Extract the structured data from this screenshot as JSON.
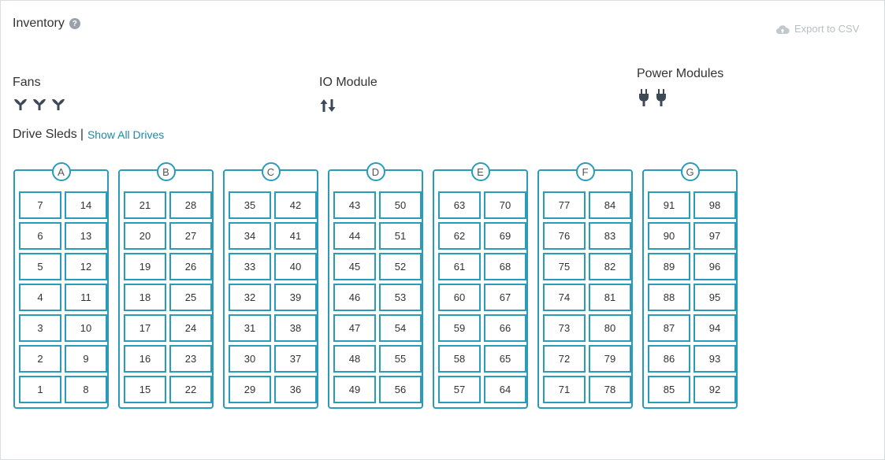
{
  "header": {
    "title": "Inventory",
    "help_glyph": "?",
    "export_label": "Export to CSV",
    "export_icon": "cloud-upload-icon"
  },
  "fans": {
    "label": "Fans",
    "count": 3,
    "icon": "fan-icon"
  },
  "io_module": {
    "label": "IO Module",
    "icon": "up-down-arrows-icon"
  },
  "power_modules": {
    "label": "Power Modules",
    "count": 2,
    "icon": "power-plug-icon"
  },
  "drive_sleds": {
    "label": "Drive Sleds",
    "separator": "|",
    "show_all_label": "Show All Drives",
    "accent_color": "#2a9bb8",
    "sleds": [
      {
        "id": "A",
        "drives": [
          "7",
          "14",
          "6",
          "13",
          "5",
          "12",
          "4",
          "11",
          "3",
          "10",
          "2",
          "9",
          "1",
          "8"
        ]
      },
      {
        "id": "B",
        "drives": [
          "21",
          "28",
          "20",
          "27",
          "19",
          "26",
          "18",
          "25",
          "17",
          "24",
          "16",
          "23",
          "15",
          "22"
        ]
      },
      {
        "id": "C",
        "drives": [
          "35",
          "42",
          "34",
          "41",
          "33",
          "40",
          "32",
          "39",
          "31",
          "38",
          "30",
          "37",
          "29",
          "36"
        ]
      },
      {
        "id": "D",
        "drives": [
          "43",
          "50",
          "44",
          "51",
          "45",
          "52",
          "46",
          "53",
          "47",
          "54",
          "48",
          "55",
          "49",
          "56"
        ]
      },
      {
        "id": "E",
        "drives": [
          "63",
          "70",
          "62",
          "69",
          "61",
          "68",
          "60",
          "67",
          "59",
          "66",
          "58",
          "65",
          "57",
          "64"
        ]
      },
      {
        "id": "F",
        "drives": [
          "77",
          "84",
          "76",
          "83",
          "75",
          "82",
          "74",
          "81",
          "73",
          "80",
          "72",
          "79",
          "71",
          "78"
        ]
      },
      {
        "id": "G",
        "drives": [
          "91",
          "98",
          "90",
          "97",
          "89",
          "96",
          "88",
          "95",
          "87",
          "94",
          "86",
          "93",
          "85",
          "92"
        ]
      }
    ]
  }
}
